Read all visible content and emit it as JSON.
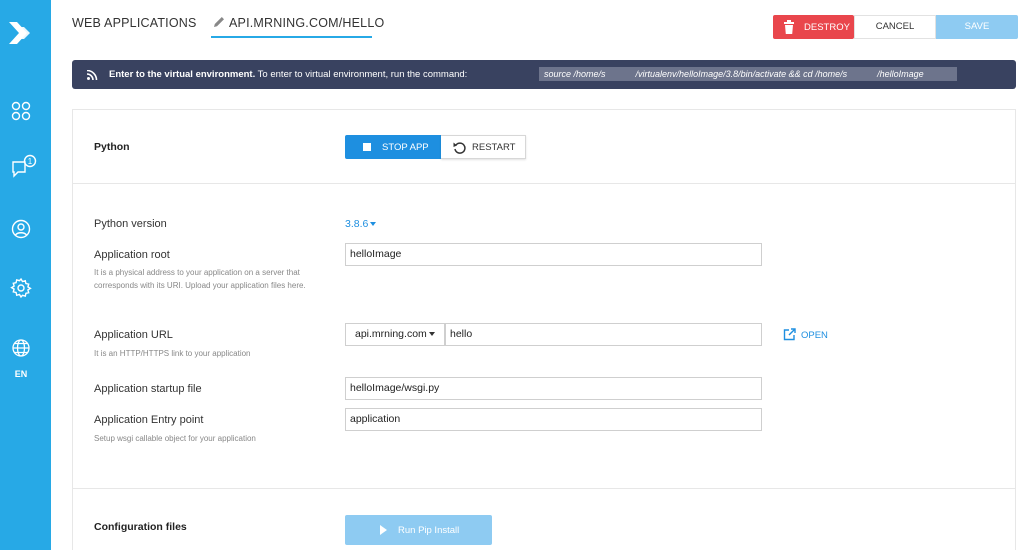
{
  "sidebar": {
    "logo_icon": "chevron-logo-icon",
    "items": [
      {
        "icon": "apps-grid-icon"
      },
      {
        "icon": "chat-bubble-icon",
        "badge": "1"
      },
      {
        "icon": "user-circle-icon"
      },
      {
        "icon": "gear-icon"
      },
      {
        "icon": "globe-icon"
      }
    ],
    "language": "EN"
  },
  "header": {
    "breadcrumb_root": "WEB APPLICATIONS",
    "breadcrumb_current": "API.MRNING.COM/HELLO",
    "edit_icon": "pencil-icon"
  },
  "actions": {
    "destroy_label": "DESTROY",
    "cancel_label": "CANCEL",
    "save_label": "SAVE"
  },
  "banner": {
    "icon": "rss-feed-icon",
    "title": "Enter to the virtual environment.",
    "text": " To enter to virtual environment, run the command:",
    "command": "source /home/s            /virtualenv/helloImage/3.8/bin/activate && cd /home/s            /helloImage"
  },
  "python_section": {
    "title": "Python",
    "stop_label": "STOP APP",
    "restart_label": "RESTART"
  },
  "form": {
    "version_label": "Python version",
    "version_value": "3.8.6",
    "root_label": "Application root",
    "root_hint": "It is a physical address to your application on a server that corresponds with its URI. Upload your application files here.",
    "root_value": "helloImage",
    "url_label": "Application URL",
    "url_hint": "It is an HTTP/HTTPS link to your application",
    "url_domain": "api.mrning.com",
    "url_path": "hello",
    "open_label": "OPEN",
    "startup_label": "Application startup file",
    "startup_value": "helloImage/wsgi.py",
    "entry_label": "Application Entry point",
    "entry_hint": "Setup wsgi callable object for your application",
    "entry_value": "application"
  },
  "config_section": {
    "title": "Configuration files",
    "pip_label": "Run Pip Install"
  },
  "colors": {
    "sidebar": "#27a9e6",
    "accent": "#1e8fe0",
    "destroy": "#e9464c",
    "banner": "#394260",
    "disabled_button": "#8ecbf2"
  }
}
